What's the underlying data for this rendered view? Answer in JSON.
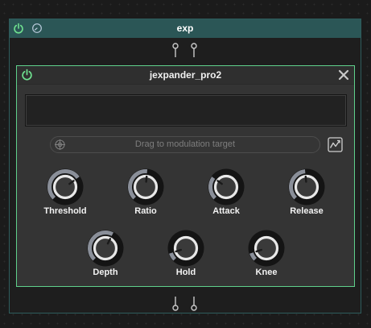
{
  "outer_node": {
    "title": "exp"
  },
  "plugin": {
    "title": "jexpander_pro2",
    "modulation_placeholder": "Drag to modulation target"
  },
  "knobs": [
    {
      "label": "Threshold",
      "value": 0.7
    },
    {
      "label": "Ratio",
      "value": 0.52
    },
    {
      "label": "Attack",
      "value": 0.3
    },
    {
      "label": "Release",
      "value": 0.48
    },
    {
      "label": "Depth",
      "value": 0.6
    },
    {
      "label": "Hold",
      "value": 0.1
    },
    {
      "label": "Knee",
      "value": 0.1
    }
  ],
  "colors": {
    "accent": "#5fd18b",
    "header_teal": "#2b5656",
    "knob_arc": "#8a8f99"
  },
  "icons": [
    "power-icon",
    "gauge-icon",
    "close-icon",
    "target-icon",
    "modulation-graph-icon"
  ]
}
